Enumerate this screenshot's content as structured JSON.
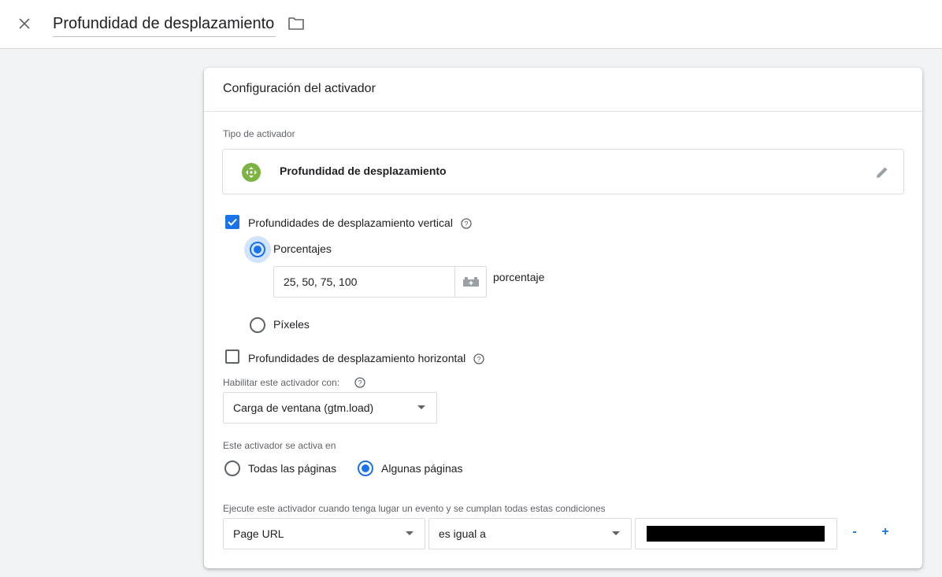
{
  "header": {
    "title": "Profundidad de desplazamiento",
    "close_icon": "close-icon",
    "folder_icon": "folder-icon"
  },
  "card": {
    "title": "Configuración del activador",
    "trigger_type": {
      "label": "Tipo de activador",
      "name": "Profundidad de desplazamiento",
      "icon": "scroll-depth-icon",
      "icon_color": "#7cb342"
    },
    "vertical": {
      "label": "Profundidades de desplazamiento vertical",
      "checked": true,
      "percent_option": "Porcentajes",
      "percent_value": "25, 50, 75, 100",
      "unit": "porcentaje",
      "pixels_option": "Píxeles"
    },
    "horizontal": {
      "label": "Profundidades de desplazamiento horizontal",
      "checked": false
    },
    "enable": {
      "label": "Habilitar este activador con:",
      "selected": "Carga de ventana (gtm.load)"
    },
    "fires_on": {
      "label": "Este activador se activa en",
      "all_pages": "Todas las páginas",
      "some_pages": "Algunas páginas",
      "selected": "some_pages"
    },
    "conditions": {
      "label": "Ejecute este activador cuando tenga lugar un evento y se cumplan todas estas condiciones",
      "variable": "Page URL",
      "operator": "es igual a",
      "minus": "-",
      "plus": "+"
    }
  },
  "colors": {
    "accent": "#1a73e8",
    "halo": "#d2e3fc",
    "border": "#dadce0",
    "background": "#f1f3f4"
  }
}
